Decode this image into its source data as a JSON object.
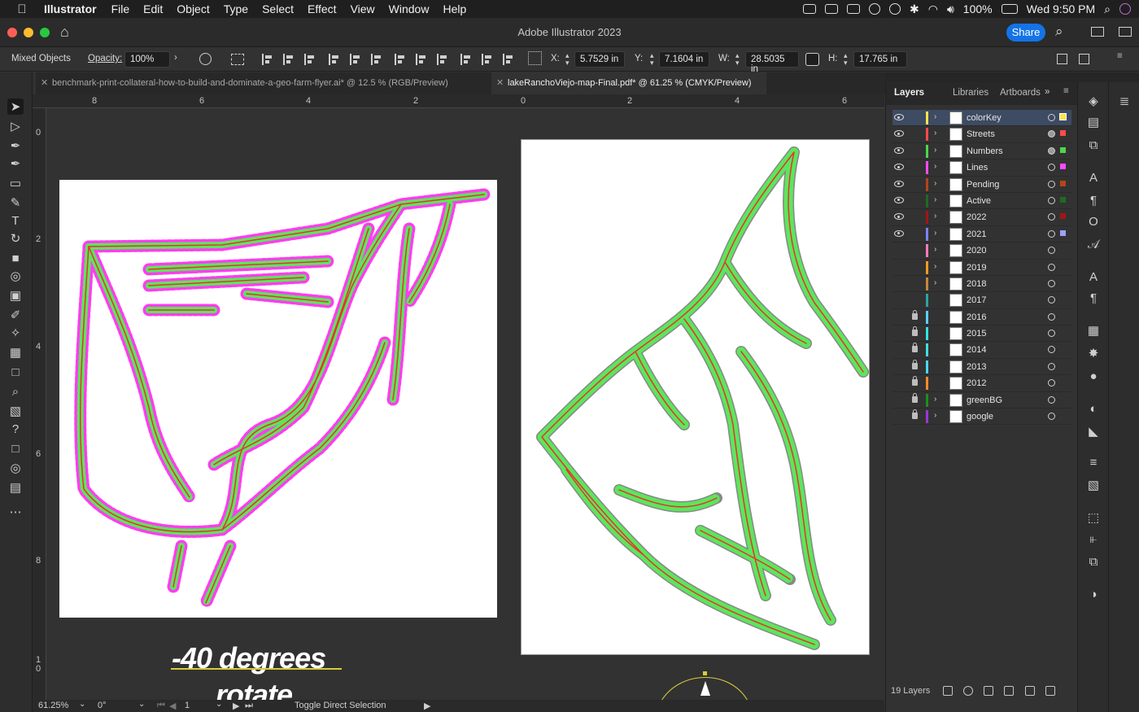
{
  "menubar": {
    "app": "Illustrator",
    "items": [
      "File",
      "Edit",
      "Object",
      "Type",
      "Select",
      "Effect",
      "View",
      "Window",
      "Help"
    ],
    "battery": "100%",
    "clock": "Wed 9:50 PM"
  },
  "window": {
    "title": "Adobe Illustrator 2023",
    "share_label": "Share"
  },
  "control": {
    "selection_label": "Mixed Objects",
    "opacity_label": "Opacity:",
    "opacity_value": "100%",
    "x_label": "X:",
    "x_value": "5.7529 in",
    "y_label": "Y:",
    "y_value": "7.1604 in",
    "w_label": "W:",
    "w_value": "28.5035 in",
    "h_label": "H:",
    "h_value": "17.765 in"
  },
  "tabs": [
    {
      "label": "benchmark-print-collateral-how-to-build-and-dominate-a-geo-farm-flyer.ai* @ 12.5 % (RGB/Preview)"
    },
    {
      "label": "lakeRanchoViejo-map-Final.pdf* @ 61.25 % (CMYK/Preview)"
    }
  ],
  "hruler_ticks": [
    "8",
    "6",
    "4",
    "2",
    "0",
    "2",
    "4",
    "6"
  ],
  "vruler_ticks": [
    "0",
    "2",
    "4",
    "6",
    "8",
    "1\n0"
  ],
  "canvas": {
    "text_line1": "-40 degrees",
    "text_line2": "rotate"
  },
  "status": {
    "zoom": "61.25%",
    "rotation": "0°",
    "artboard": "1",
    "tool_hint": "Toggle Direct Selection"
  },
  "panel_tabs": {
    "layers": "Layers",
    "libraries": "Libraries",
    "artboards": "Artboards"
  },
  "layers": [
    {
      "name": "colorKey",
      "color": "#ffe34d",
      "visible": true,
      "locked": false,
      "expandable": true,
      "selected": true,
      "target_filled": false,
      "sq": "#ffe34d"
    },
    {
      "name": "Streets",
      "color": "#ff4a4a",
      "visible": true,
      "locked": false,
      "expandable": true,
      "selected": false,
      "target_filled": true,
      "sq": "#ff4a4a"
    },
    {
      "name": "Numbers",
      "color": "#4ad94a",
      "visible": true,
      "locked": false,
      "expandable": true,
      "selected": false,
      "target_filled": true,
      "sq": "#4ad94a"
    },
    {
      "name": "Lines",
      "color": "#ff4aff",
      "visible": true,
      "locked": false,
      "expandable": true,
      "selected": false,
      "target_filled": false,
      "sq": "#ff4aff"
    },
    {
      "name": "Pending",
      "color": "#b8421a",
      "visible": true,
      "locked": false,
      "expandable": true,
      "selected": false,
      "target_filled": false,
      "sq": "#b8421a"
    },
    {
      "name": "Active",
      "color": "#1f6b1f",
      "visible": true,
      "locked": false,
      "expandable": true,
      "selected": false,
      "target_filled": false,
      "sq": "#1f6b1f"
    },
    {
      "name": "2022",
      "color": "#a31515",
      "visible": true,
      "locked": false,
      "expandable": true,
      "selected": false,
      "target_filled": false,
      "sq": "#a31515"
    },
    {
      "name": "2021",
      "color": "#7b83ff",
      "visible": true,
      "locked": false,
      "expandable": true,
      "selected": false,
      "target_filled": false,
      "sq": "#9ba2ff"
    },
    {
      "name": "2020",
      "color": "#ff7ab8",
      "visible": false,
      "locked": false,
      "expandable": true,
      "selected": false,
      "target_filled": false,
      "sq": ""
    },
    {
      "name": "2019",
      "color": "#ff9a1f",
      "visible": false,
      "locked": false,
      "expandable": true,
      "selected": false,
      "target_filled": false,
      "sq": ""
    },
    {
      "name": "2018",
      "color": "#c8863c",
      "visible": false,
      "locked": false,
      "expandable": true,
      "selected": false,
      "target_filled": false,
      "sq": ""
    },
    {
      "name": "2017",
      "color": "#2fa3a3",
      "visible": false,
      "locked": false,
      "expandable": false,
      "selected": false,
      "target_filled": false,
      "sq": ""
    },
    {
      "name": "2016",
      "color": "#5ad0ff",
      "visible": false,
      "locked": true,
      "expandable": false,
      "selected": false,
      "target_filled": false,
      "sq": ""
    },
    {
      "name": "2015",
      "color": "#30e3e3",
      "visible": false,
      "locked": true,
      "expandable": false,
      "selected": false,
      "target_filled": false,
      "sq": ""
    },
    {
      "name": "2014",
      "color": "#3fe0e0",
      "visible": false,
      "locked": true,
      "expandable": false,
      "selected": false,
      "target_filled": false,
      "sq": ""
    },
    {
      "name": "2013",
      "color": "#49d8ff",
      "visible": false,
      "locked": true,
      "expandable": false,
      "selected": false,
      "target_filled": false,
      "sq": ""
    },
    {
      "name": "2012",
      "color": "#ff8a2a",
      "visible": false,
      "locked": true,
      "expandable": false,
      "selected": false,
      "target_filled": false,
      "sq": ""
    },
    {
      "name": "greenBG",
      "color": "#1f8f1f",
      "visible": false,
      "locked": true,
      "expandable": true,
      "selected": false,
      "target_filled": false,
      "sq": ""
    },
    {
      "name": "google",
      "color": "#9a36d8",
      "visible": false,
      "locked": true,
      "expandable": true,
      "selected": false,
      "target_filled": false,
      "sq": ""
    }
  ],
  "layers_count": "19 Layers",
  "colors": {
    "accent": "#1473e6",
    "selection_magenta": "#ff3cf0",
    "street_red": "#e8322d",
    "lot_green": "#5ce65c"
  }
}
